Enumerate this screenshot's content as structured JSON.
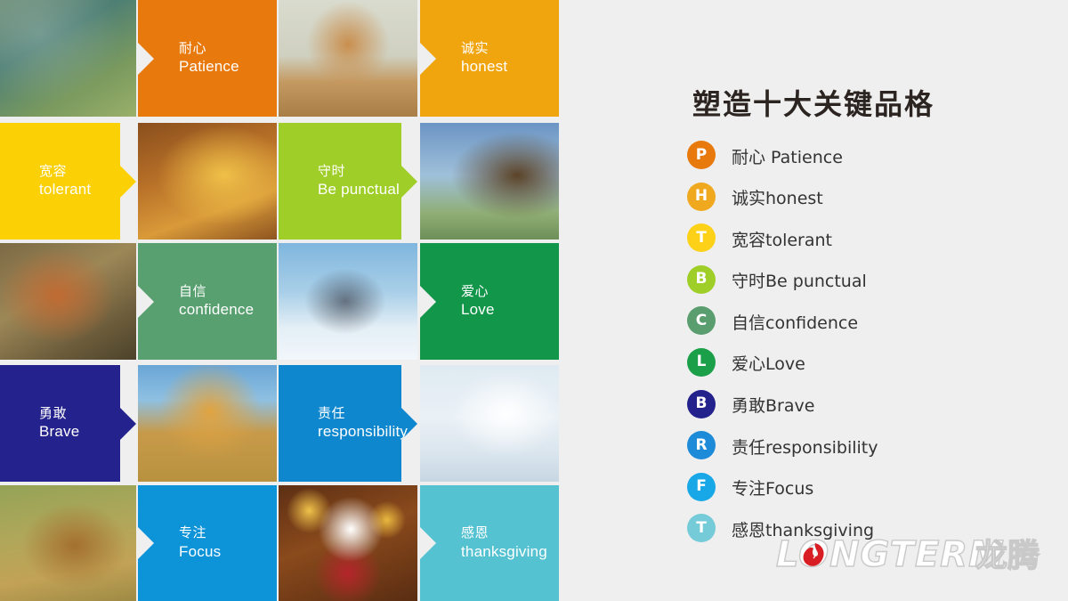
{
  "background_color": "#efefef",
  "grid": {
    "columns": 4,
    "rows": 5,
    "cells": [
      {
        "kind": "photo",
        "subject": "butterfly-on-plant",
        "row": 1,
        "col": 1
      },
      {
        "kind": "tile",
        "cn": "耐心",
        "en": "Patience",
        "color": "#E8790C",
        "notch": "left",
        "row": 1,
        "col": 2
      },
      {
        "kind": "photo",
        "subject": "cheetah-cub-running",
        "row": 1,
        "col": 3
      },
      {
        "kind": "tile",
        "cn": "诚实",
        "en": "honest",
        "color": "#F0A50F",
        "notch": "left",
        "row": 1,
        "col": 4
      },
      {
        "kind": "tile",
        "cn": "宽容",
        "en": "tolerant",
        "color": "#FBD005",
        "notch": "right",
        "row": 2,
        "col": 1
      },
      {
        "kind": "photo",
        "subject": "tortoise",
        "row": 2,
        "col": 2
      },
      {
        "kind": "tile",
        "cn": "守时",
        "en": "Be punctual",
        "color": "#A0CE28",
        "notch": "right",
        "row": 2,
        "col": 3
      },
      {
        "kind": "photo",
        "subject": "eagle-in-flight",
        "row": 2,
        "col": 4
      },
      {
        "kind": "photo",
        "subject": "red-squirrel",
        "row": 3,
        "col": 1
      },
      {
        "kind": "tile",
        "cn": "自信",
        "en": "confidence",
        "color": "#58A070",
        "notch": "left",
        "row": 3,
        "col": 2
      },
      {
        "kind": "photo",
        "subject": "two-penguins",
        "row": 3,
        "col": 3
      },
      {
        "kind": "tile",
        "cn": "爱心",
        "en": "Love",
        "color": "#12964A",
        "notch": "left",
        "row": 3,
        "col": 4
      },
      {
        "kind": "tile",
        "cn": "勇敢",
        "en": "Brave",
        "color": "#24228C",
        "notch": "right",
        "row": 4,
        "col": 1
      },
      {
        "kind": "photo",
        "subject": "lion",
        "row": 4,
        "col": 2
      },
      {
        "kind": "tile",
        "cn": "责任",
        "en": "responsibility",
        "color": "#0E87CE",
        "notch": "right",
        "row": 4,
        "col": 3
      },
      {
        "kind": "photo",
        "subject": "white-dove-flying",
        "row": 4,
        "col": 4
      },
      {
        "kind": "photo",
        "subject": "deer-family",
        "row": 5,
        "col": 1
      },
      {
        "kind": "tile",
        "cn": "专注",
        "en": "Focus",
        "color": "#0D93D8",
        "notch": "left",
        "row": 5,
        "col": 2
      },
      {
        "kind": "photo",
        "subject": "white-pomeranian-dog",
        "row": 5,
        "col": 3
      },
      {
        "kind": "tile",
        "cn": "感恩",
        "en": "thanksgiving",
        "color": "#55C2D2",
        "notch": "left",
        "row": 5,
        "col": 4
      }
    ]
  },
  "panel": {
    "title": "塑造十大关键品格",
    "title_color": "#2b2421",
    "items": [
      {
        "letter": "P",
        "label": "耐心 Patience",
        "color": "#E8790C"
      },
      {
        "letter": "H",
        "label": "诚实honest",
        "color": "#F0A81E"
      },
      {
        "letter": "T",
        "label": "宽容tolerant",
        "color": "#FCD117"
      },
      {
        "letter": "B",
        "label": "守时Be punctual",
        "color": "#A0CE28"
      },
      {
        "letter": "C",
        "label": "自信confidence",
        "color": "#5A9E6F"
      },
      {
        "letter": "L",
        "label": "爱心Love",
        "color": "#1BA049"
      },
      {
        "letter": "B",
        "label": "勇敢Brave",
        "color": "#23218C"
      },
      {
        "letter": "R",
        "label": "责任responsibility",
        "color": "#1E8BD8"
      },
      {
        "letter": "F",
        "label": "专注Focus",
        "color": "#18A8E8"
      },
      {
        "letter": "T",
        "label": "感恩thanksgiving",
        "color": "#76CBD8"
      }
    ]
  },
  "logo": {
    "latin_text": "LONGTERM",
    "cn_text": "龙腾",
    "mark_color": "#D81E24",
    "text_color": "#ffffff"
  }
}
